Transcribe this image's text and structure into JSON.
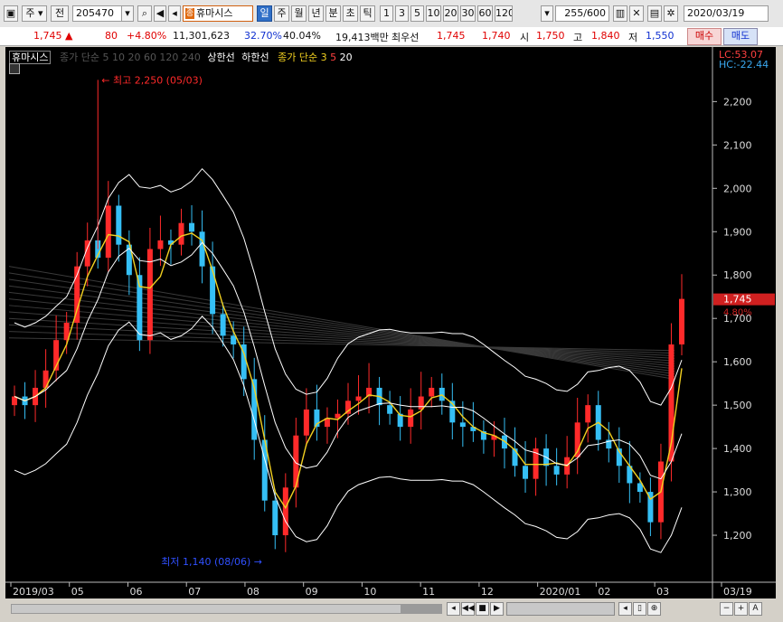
{
  "toolbar": {
    "period_type": "주",
    "market": "전",
    "stock_code": "205470",
    "stock_name": "휴마시스",
    "stock_badge": "종",
    "intervals": [
      "일",
      "주",
      "월",
      "년",
      "분",
      "초",
      "틱"
    ],
    "active_interval": "일",
    "numbers": [
      "1",
      "3",
      "5",
      "10",
      "20",
      "30",
      "60",
      "120"
    ],
    "count_display": "255",
    "count_total": "/600",
    "date": "2020/03/19"
  },
  "quote": {
    "price": "1,745",
    "arrow": "▲",
    "change": "80",
    "change_pct": "+4.80%",
    "volume": "11,301,623",
    "volume_ratio": "32.70%",
    "turnover": "40.04%",
    "amount": "19,413백만",
    "best_label": "최우선",
    "ask": "1,745",
    "bid": "1,740",
    "open_label": "시",
    "open": "1,750",
    "high_label": "고",
    "high": "1,840",
    "low_label": "저",
    "low": "1,550",
    "buy_button": "매수",
    "sell_button": "매도"
  },
  "chart_legend": {
    "name": "휴마시스",
    "ma_label": "종가 단순 5 10 20 60 120 240",
    "limit_up": "상한선",
    "limit_down": "하한선",
    "ma2_label": "종가 단순 3",
    "ma2_values": [
      "5",
      "20"
    ],
    "lc": "LC:53.07",
    "hc": "HC:-22.44"
  },
  "annotations": {
    "high": "최고 2,250 (05/03)",
    "low": "최저 1,140 (08/06)",
    "current_price": "1,745",
    "current_pct": "4.80%"
  },
  "colors": {
    "up": "#ff2a2a",
    "down": "#35bff5",
    "band": "#ffffff",
    "ma_yellow": "#f2d020"
  },
  "chart_data": {
    "type": "candlestick",
    "ylim": [
      1100,
      2280
    ],
    "y_ticks": [
      "2,200",
      "2,100",
      "2,000",
      "1,900",
      "1,800",
      "1,700",
      "1,600",
      "1,500",
      "1,400",
      "1,300",
      "1,200"
    ],
    "x_ticks": [
      "2019/03",
      "05",
      "06",
      "07",
      "08",
      "09",
      "10",
      "11",
      "12",
      "2020/01",
      "02",
      "03",
      "03/19"
    ],
    "close_series": [
      1520,
      1500,
      1540,
      1580,
      1650,
      1690,
      1820,
      1880,
      1840,
      1960,
      1870,
      1800,
      1650,
      1860,
      1880,
      1870,
      1920,
      1900,
      1820,
      1710,
      1660,
      1640,
      1560,
      1420,
      1280,
      1200,
      1310,
      1430,
      1490,
      1450,
      1470,
      1480,
      1510,
      1520,
      1540,
      1500,
      1480,
      1450,
      1490,
      1520,
      1540,
      1510,
      1460,
      1450,
      1440,
      1420,
      1430,
      1400,
      1360,
      1330,
      1400,
      1360,
      1340,
      1380,
      1460,
      1500,
      1420,
      1400,
      1360,
      1320,
      1300,
      1230,
      1370,
      1640,
      1745
    ]
  }
}
